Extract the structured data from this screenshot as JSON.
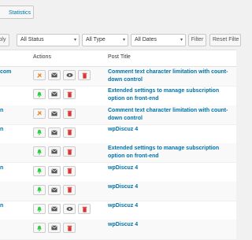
{
  "toolbar": {
    "stats_label": "Statistics"
  },
  "filters": {
    "apply_label": "ply",
    "status": "All Status",
    "type": "All Type",
    "dates": "All Dates",
    "filter_label": "Filter",
    "reset_label": "Reset Filte"
  },
  "table": {
    "headers": {
      "actions": "Actions",
      "post_title": "Post Title"
    },
    "rows": [
      {
        "author": "com",
        "actions": [
          "approve-orange",
          "email",
          "view",
          "delete"
        ],
        "title": "Comment text character limitation with count-down control",
        "alt": true
      },
      {
        "author": "",
        "actions": [
          "approve-green",
          "email",
          "delete"
        ],
        "title": "Extended settings to manage subscription option on front-end",
        "alt": false
      },
      {
        "author": "n",
        "actions": [
          "approve-orange",
          "email",
          "delete"
        ],
        "title": "Comment text character limitation with count-down control",
        "alt": true
      },
      {
        "author": "n",
        "actions": [
          "approve-green",
          "email",
          "delete"
        ],
        "title": "wpDiscuz 4",
        "alt": false
      },
      {
        "author": "",
        "actions": [
          "approve-green",
          "email",
          "delete"
        ],
        "title": "Extended settings to manage subscription option on front-end",
        "alt": true
      },
      {
        "author": "n",
        "actions": [
          "approve-green",
          "email",
          "delete"
        ],
        "title": "wpDiscuz 4",
        "alt": false
      },
      {
        "author": "",
        "actions": [
          "approve-green",
          "email",
          "delete"
        ],
        "title": "wpDiscuz 4",
        "alt": true
      },
      {
        "author": "n",
        "actions": [
          "approve-green",
          "email",
          "view",
          "delete"
        ],
        "title": "wpDiscuz 4",
        "alt": false
      },
      {
        "author": "",
        "actions": [
          "approve-green",
          "email",
          "delete"
        ],
        "title": "wpDiscuz 4",
        "alt": true
      }
    ]
  },
  "colors": {
    "link": "#0073aa",
    "approve_orange": "#e67e22",
    "approve_green": "#2ecc40",
    "delete": "#dc3232",
    "neutral": "#555555"
  }
}
